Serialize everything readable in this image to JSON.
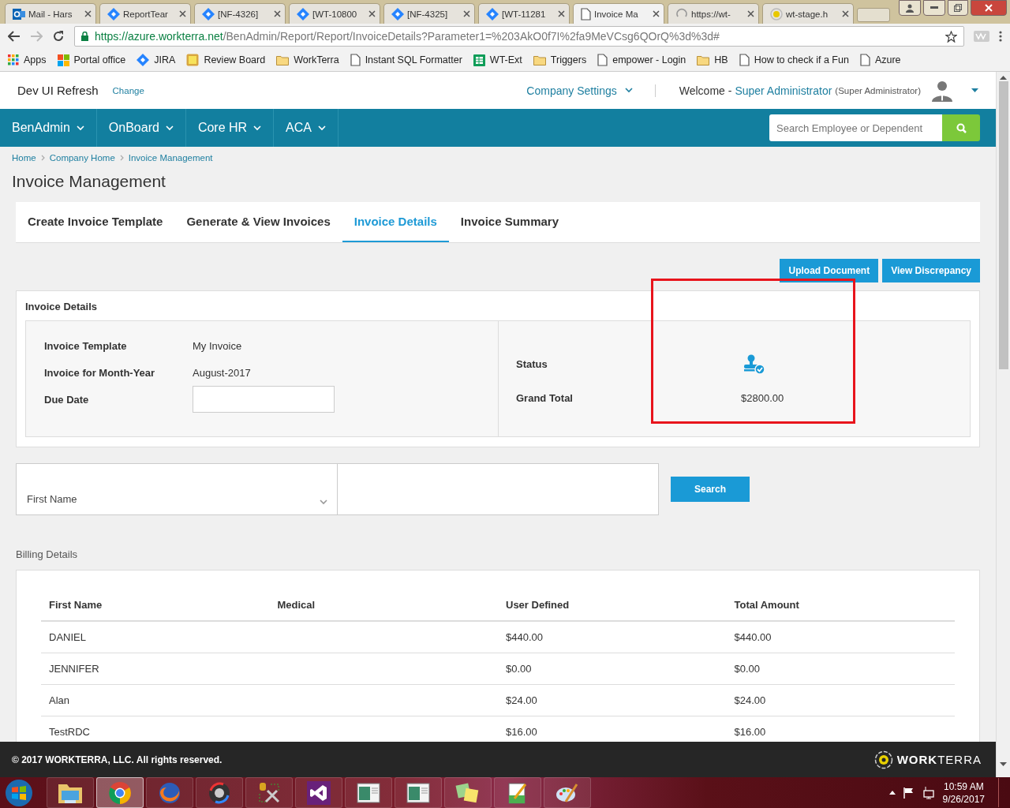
{
  "browser": {
    "tabs": [
      {
        "title": "Mail - Hars",
        "kind": "mail",
        "selected": false
      },
      {
        "title": "ReportTear",
        "kind": "jira",
        "selected": false
      },
      {
        "title": "[NF-4326]",
        "kind": "jira",
        "selected": false
      },
      {
        "title": "[WT-10800",
        "kind": "jira",
        "selected": false
      },
      {
        "title": "[NF-4325]",
        "kind": "jira",
        "selected": false
      },
      {
        "title": "[WT-11281",
        "kind": "jira",
        "selected": false
      },
      {
        "title": "Invoice Ma",
        "kind": "page",
        "selected": true
      },
      {
        "title": "https://wt-",
        "kind": "loading",
        "selected": false
      },
      {
        "title": "wt-stage.h",
        "kind": "site",
        "selected": false
      }
    ],
    "url": {
      "host": "https://azure.workterra.net",
      "path": "/BenAdmin/Report/Report/InvoiceDetails?Parameter1=%203AkO0f7I%2fa9MeVCsg6QOrQ%3d%3d#"
    },
    "bookmarks": [
      {
        "label": "Apps",
        "kind": "apps"
      },
      {
        "label": "Portal office",
        "kind": "office"
      },
      {
        "label": "JIRA",
        "kind": "jira"
      },
      {
        "label": "Review Board",
        "kind": "note"
      },
      {
        "label": "WorkTerra",
        "kind": "folder"
      },
      {
        "label": "Instant SQL Formatter",
        "kind": "page"
      },
      {
        "label": "WT-Ext",
        "kind": "sheet"
      },
      {
        "label": "Triggers",
        "kind": "folder"
      },
      {
        "label": "empower - Login",
        "kind": "page"
      },
      {
        "label": "HB",
        "kind": "folder"
      },
      {
        "label": "How to check if a Fun",
        "kind": "page"
      },
      {
        "label": "Azure",
        "kind": "page"
      }
    ]
  },
  "header": {
    "app_name": "Dev UI Refresh",
    "change_link": "Change",
    "company_settings": "Company Settings",
    "welcome": "Welcome -",
    "user_name": "Super Administrator",
    "user_role": "(Super Administrator)"
  },
  "nav": {
    "items": [
      "BenAdmin",
      "OnBoard",
      "Core HR",
      "ACA"
    ],
    "search": {
      "placeholder": "Search Employee or Dependent"
    }
  },
  "breadcrumbs": [
    "Home",
    "Company Home",
    "Invoice Management"
  ],
  "page_title": "Invoice Management",
  "tabs": [
    {
      "label": "Create Invoice Template",
      "selected": false
    },
    {
      "label": "Generate & View Invoices",
      "selected": false
    },
    {
      "label": "Invoice Details",
      "selected": true
    },
    {
      "label": "Invoice Summary",
      "selected": false
    }
  ],
  "actions": [
    "Upload Document",
    "View Discrepancy"
  ],
  "invoice_details": {
    "title": "Invoice Details",
    "fields": [
      {
        "label": "Invoice Template",
        "value": "My Invoice",
        "kind": "text"
      },
      {
        "label": "Invoice for Month-Year",
        "value": "August-2017",
        "kind": "text"
      },
      {
        "label": "Due Date",
        "kind": "input"
      }
    ],
    "status_label": "Status",
    "grand_total_label": "Grand Total",
    "grand_total": "$2800.00"
  },
  "filter": {
    "field": "First Name",
    "button": "Search"
  },
  "billing": {
    "title": "Billing Details",
    "columns": [
      "First Name",
      "Medical",
      "User Defined",
      "Total Amount"
    ],
    "rows": [
      [
        "DANIEL",
        "",
        "$440.00",
        "$440.00"
      ],
      [
        "JENNIFER",
        "",
        "$0.00",
        "$0.00"
      ],
      [
        "Alan",
        "",
        "$24.00",
        "$24.00"
      ],
      [
        "TestRDC",
        "",
        "$16.00",
        "$16.00"
      ]
    ]
  },
  "footer": {
    "copyright": "© 2017 WORKTERRA, LLC. All rights reserved.",
    "logo": "**WORK**TERRA"
  },
  "taskbar": {
    "apps": [
      {
        "kind": "folder",
        "selected": false
      },
      {
        "kind": "chrome",
        "selected": true
      },
      {
        "kind": "firefox",
        "selected": false
      },
      {
        "kind": "media",
        "selected": false
      },
      {
        "kind": "tools",
        "selected": false
      },
      {
        "kind": "vs",
        "selected": false
      },
      {
        "kind": "window",
        "selected": false
      },
      {
        "kind": "window",
        "selected": false
      },
      {
        "kind": "sticky",
        "selected": false
      },
      {
        "kind": "notepad",
        "selected": false
      },
      {
        "kind": "paint",
        "selected": false
      }
    ],
    "time": "10:59 AM",
    "date": "9/26/2017"
  }
}
